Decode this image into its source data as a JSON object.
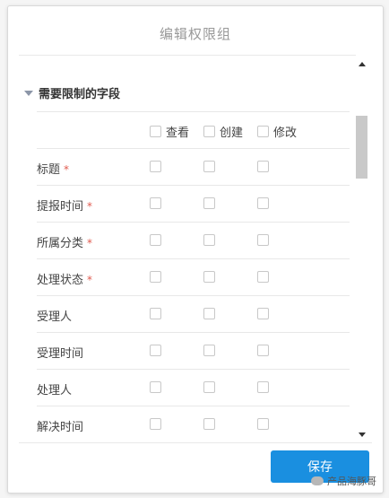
{
  "dialog": {
    "title": "编辑权限组"
  },
  "section": {
    "title": "需要限制的字段"
  },
  "columns": [
    "查看",
    "创建",
    "修改"
  ],
  "required_mark": "*",
  "fields": [
    {
      "label": "标题",
      "required": true
    },
    {
      "label": "提报时间",
      "required": true
    },
    {
      "label": "所属分类",
      "required": true
    },
    {
      "label": "处理状态",
      "required": true
    },
    {
      "label": "受理人",
      "required": false
    },
    {
      "label": "受理时间",
      "required": false
    },
    {
      "label": "处理人",
      "required": false
    },
    {
      "label": "解决时间",
      "required": false
    }
  ],
  "footer": {
    "save_label": "保存"
  },
  "watermark": {
    "right_text": "产品海豚哥"
  },
  "colors": {
    "primary": "#1a8fe0",
    "required": "#e05a4e"
  },
  "icons": {
    "section_toggle": "caret-down-icon",
    "scroll_up": "arrow-up-icon",
    "scroll_down": "arrow-down-icon"
  }
}
